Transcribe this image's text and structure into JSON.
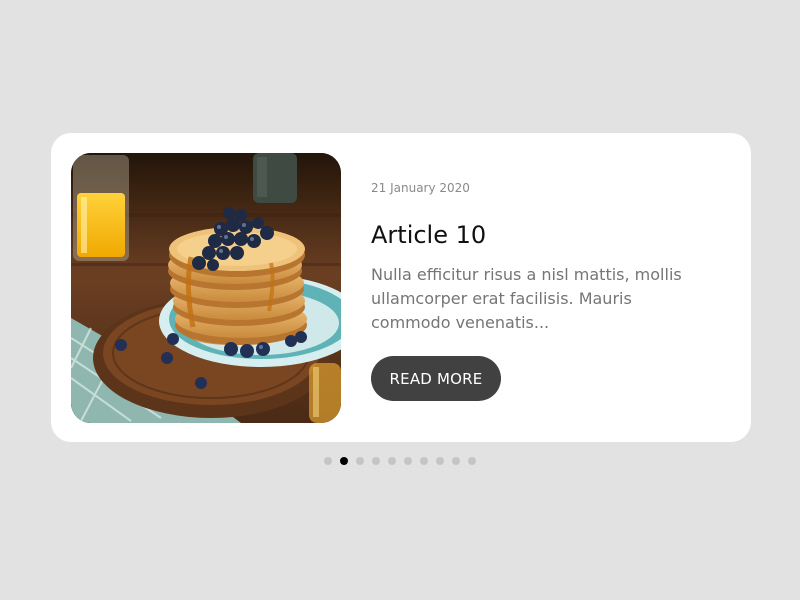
{
  "article": {
    "date": "21 January 2020",
    "title": "Article 10",
    "excerpt": "Nulla efficitur risus a nisl mattis, mollis ullamcorper erat facilisis. Mauris commodo venenatis...",
    "button_label": "READ MORE",
    "image_subject": "stack of pancakes with blueberries and syrup"
  },
  "pagination": {
    "total": 10,
    "active_index": 1
  },
  "colors": {
    "background": "#e2e2e2",
    "card": "#ffffff",
    "button": "#414141",
    "dot_inactive": "#c4c4c4",
    "dot_active": "#000000"
  }
}
